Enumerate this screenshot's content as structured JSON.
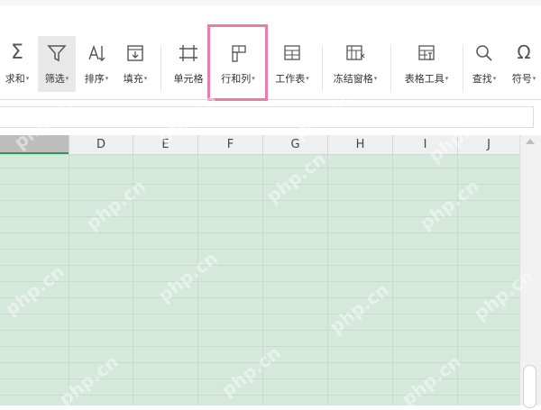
{
  "ribbon": {
    "tools": [
      {
        "id": "sum",
        "label": "求和",
        "dropdown": true,
        "icon": "sigma-icon"
      },
      {
        "id": "filter",
        "label": "筛选",
        "dropdown": true,
        "icon": "filter-icon"
      },
      {
        "id": "sort",
        "label": "排序",
        "dropdown": true,
        "icon": "sort-icon"
      },
      {
        "id": "fill",
        "label": "填充",
        "dropdown": true,
        "icon": "fill-down-icon"
      },
      {
        "id": "cell",
        "label": "单元格",
        "dropdown": false,
        "icon": "cell-format-icon"
      },
      {
        "id": "rowcol",
        "label": "行和列",
        "dropdown": true,
        "icon": "row-column-icon"
      },
      {
        "id": "sheet",
        "label": "工作表",
        "dropdown": true,
        "icon": "worksheet-icon"
      },
      {
        "id": "freeze",
        "label": "冻结窗格",
        "dropdown": true,
        "icon": "freeze-panes-icon"
      },
      {
        "id": "tabletools",
        "label": "表格工具",
        "dropdown": true,
        "icon": "table-tools-icon"
      },
      {
        "id": "find",
        "label": "查找",
        "dropdown": true,
        "icon": "search-icon"
      },
      {
        "id": "symbol",
        "label": "符号",
        "dropdown": true,
        "icon": "omega-icon"
      }
    ],
    "dropdown_glyph": "▾"
  },
  "sheet": {
    "columns": [
      "D",
      "E",
      "F",
      "G",
      "H",
      "I",
      "J"
    ],
    "selection_color": "#d4e8dc",
    "header_selected_color": "#bdbdbd",
    "accent": "#2e9b54"
  },
  "highlight": {
    "target": "行和列",
    "color": "#ee7aa6"
  },
  "watermark": "php.cn"
}
